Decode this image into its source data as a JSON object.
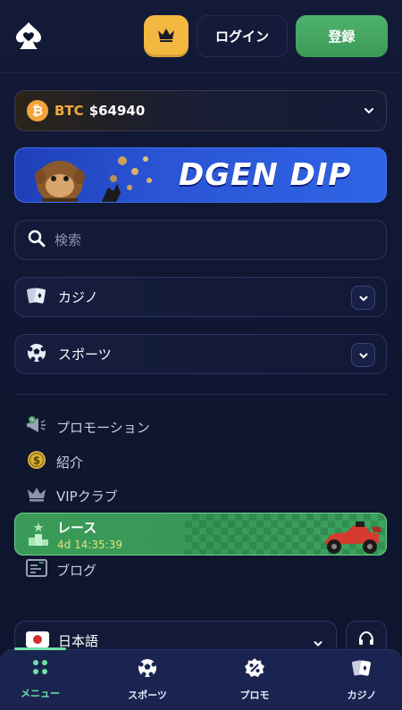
{
  "header": {
    "logo_icon": "spade-heart-logo-icon",
    "vip_icon": "crown-icon",
    "login_label": "ログイン",
    "register_label": "登録"
  },
  "currency": {
    "symbol": "BTC",
    "price": "$64940",
    "icon": "bitcoin-icon"
  },
  "banner": {
    "title": "DGEN DIP"
  },
  "search": {
    "placeholder": "検索"
  },
  "sections": [
    {
      "label": "カジノ",
      "icon": "cards-icon"
    },
    {
      "label": "スポーツ",
      "icon": "soccer-ball-icon"
    }
  ],
  "nav": [
    {
      "label": "プロモーション",
      "icon": "megaphone-icon"
    },
    {
      "label": "紹介",
      "icon": "dollar-coin-icon"
    },
    {
      "label": "VIPクラブ",
      "icon": "crown-icon"
    },
    {
      "label": "ブログ",
      "icon": "blog-icon"
    }
  ],
  "race": {
    "title": "レース",
    "timer": "4d 14:35:39"
  },
  "language": {
    "label": "日本語",
    "flag": "japan-flag-icon"
  },
  "bottom_nav": [
    {
      "label": "メニュー",
      "icon": "menu-grid-icon",
      "active": true
    },
    {
      "label": "スポーツ",
      "icon": "soccer-ball-icon",
      "active": false
    },
    {
      "label": "プロモ",
      "icon": "percent-badge-icon",
      "active": false
    },
    {
      "label": "カジノ",
      "icon": "cards-icon",
      "active": false
    }
  ],
  "colors": {
    "background": "#0f1630",
    "accent_green": "#3a9a57",
    "crown_yellow": "#f4b740",
    "bitcoin_orange": "#f2a33a",
    "banner_blue": "#2a55d6",
    "active_tab": "#6fe3a6"
  }
}
